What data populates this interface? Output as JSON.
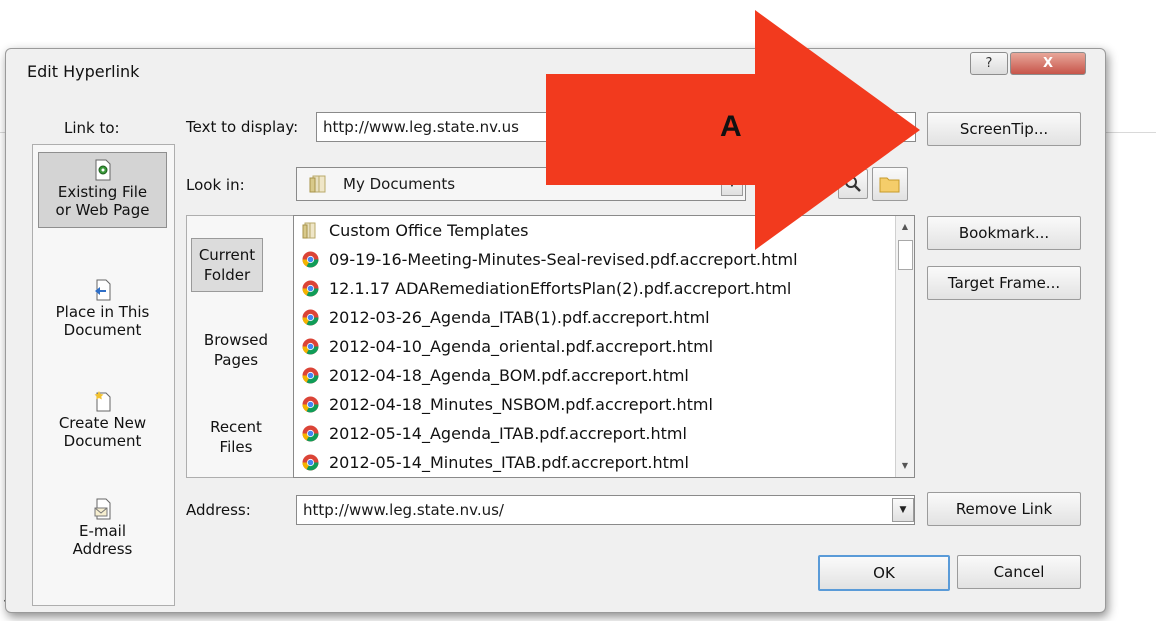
{
  "dialog": {
    "title": "Edit Hyperlink",
    "help_glyph": "?",
    "close_glyph": "X"
  },
  "link_to": {
    "label": "Link to:",
    "items": [
      {
        "line1": "Existing File",
        "line2": "or Web Page",
        "icon": "existing-file-icon",
        "selected": true
      },
      {
        "line1": "Place in This",
        "line2": "Document",
        "icon": "place-in-document-icon",
        "selected": false
      },
      {
        "line1": "Create New",
        "line2": "Document",
        "icon": "create-new-document-icon",
        "selected": false
      },
      {
        "line1": "E-mail",
        "line2": "Address",
        "icon": "email-address-icon",
        "selected": false
      }
    ]
  },
  "text_to_display": {
    "label": "Text to display:",
    "value": "http://www.leg.state.nv.us"
  },
  "look_in": {
    "label": "Look in:",
    "value": "My Documents",
    "icon": "folder-icon"
  },
  "nav": {
    "items": [
      {
        "line1": "Current",
        "line2": "Folder",
        "selected": true
      },
      {
        "line1": "Browsed",
        "line2": "Pages",
        "selected": false
      },
      {
        "line1": "Recent",
        "line2": "Files",
        "selected": false
      }
    ]
  },
  "files": [
    {
      "name": "Custom Office Templates",
      "icon": "folder-icon"
    },
    {
      "name": "09-19-16-Meeting-Minutes-Seal-revised.pdf.accreport.html",
      "icon": "chrome-icon"
    },
    {
      "name": "12.1.17 ADARemediationEffortsPlan(2).pdf.accreport.html",
      "icon": "chrome-icon"
    },
    {
      "name": "2012-03-26_Agenda_ITAB(1).pdf.accreport.html",
      "icon": "chrome-icon"
    },
    {
      "name": "2012-04-10_Agenda_oriental.pdf.accreport.html",
      "icon": "chrome-icon"
    },
    {
      "name": "2012-04-18_Agenda_BOM.pdf.accreport.html",
      "icon": "chrome-icon"
    },
    {
      "name": "2012-04-18_Minutes_NSBOM.pdf.accreport.html",
      "icon": "chrome-icon"
    },
    {
      "name": "2012-05-14_Agenda_ITAB.pdf.accreport.html",
      "icon": "chrome-icon"
    },
    {
      "name": "2012-05-14_Minutes_ITAB.pdf.accreport.html",
      "icon": "chrome-icon"
    }
  ],
  "address": {
    "label": "Address:",
    "value": "http://www.leg.state.nv.us/"
  },
  "buttons": {
    "screentip": "ScreenTip...",
    "bookmark": "Bookmark...",
    "target_frame": "Target Frame...",
    "remove_link": "Remove Link",
    "ok": "OK",
    "cancel": "Cancel"
  },
  "annotation": {
    "label": "A",
    "color": "#f23a1e"
  }
}
